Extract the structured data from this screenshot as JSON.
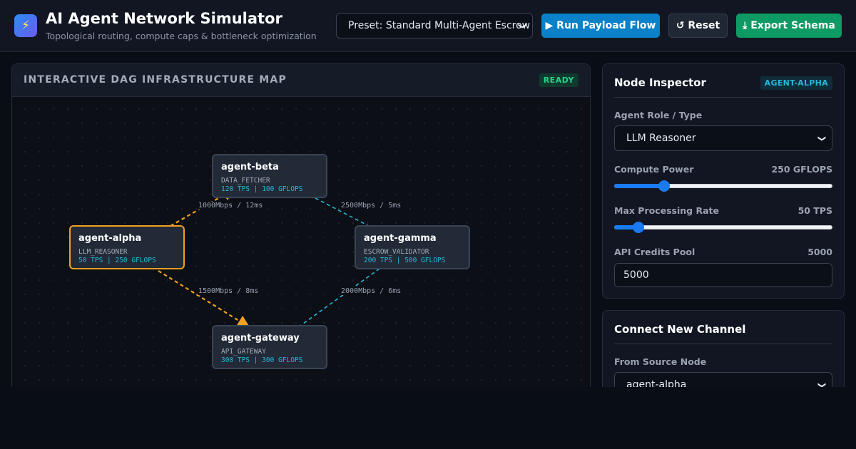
{
  "header": {
    "logo_glyph": "⚡",
    "title": "AI Agent Network Simulator",
    "subtitle": "Topological routing, compute caps & bottleneck optimization",
    "preset_value": "Preset: Standard Multi-Agent Escrow",
    "run_label": "▶ Run Payload Flow",
    "reset_label": "↺ Reset",
    "export_label": "⤓ Export Schema"
  },
  "map": {
    "title": "Interactive DAG Infrastructure Map",
    "status": "READY",
    "nodes": [
      {
        "name": "agent-beta",
        "role": "DATA_FETCHER",
        "stats": "120 TPS | 100 GFLOPS"
      },
      {
        "name": "agent-alpha",
        "role": "LLM_REASONER",
        "stats": "50 TPS | 250 GFLOPS"
      },
      {
        "name": "agent-gamma",
        "role": "ESCROW_VALIDATOR",
        "stats": "200 TPS | 500 GFLOPS"
      },
      {
        "name": "agent-gateway",
        "role": "API_GATEWAY",
        "stats": "300 TPS | 300 GFLOPS"
      }
    ],
    "edges": [
      {
        "label": "1000Mbps / 12ms"
      },
      {
        "label": "2500Mbps / 5ms"
      },
      {
        "label": "1500Mbps / 8ms"
      },
      {
        "label": "2000Mbps / 6ms"
      }
    ]
  },
  "inspector": {
    "title": "Node Inspector",
    "selected_tag": "AGENT-ALPHA",
    "role_label": "Agent Role / Type",
    "role_value": "LLM Reasoner",
    "compute_label": "Compute Power",
    "compute_value": "250 GFLOPS",
    "compute_fraction": 0.23,
    "rate_label": "Max Processing Rate",
    "rate_value": "50 TPS",
    "rate_fraction": 0.11,
    "credits_label": "API Credits Pool",
    "credits_value": "5000",
    "credits_input": "5000"
  },
  "connect": {
    "title": "Connect New Channel",
    "from_label": "From Source Node",
    "from_value": "agent-alpha"
  },
  "colors": {
    "accent_orange": "#f0a020",
    "accent_cyan": "#25b7d8",
    "run_blue": "#0a81c8",
    "export_green": "#0e9a63"
  }
}
